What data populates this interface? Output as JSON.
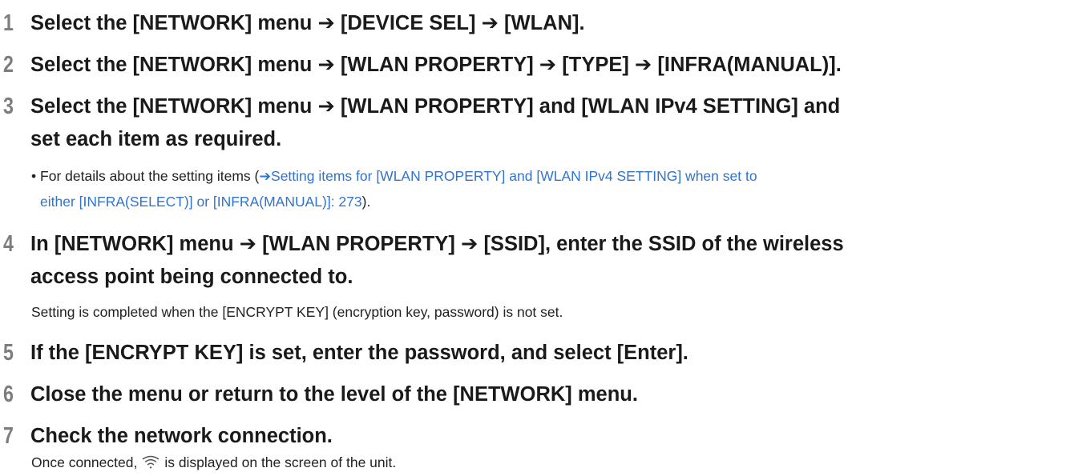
{
  "steps": [
    {
      "num": "1",
      "lines": [
        "Select the [NETWORK] menu ➔ [DEVICE SEL] ➔ [WLAN]."
      ]
    },
    {
      "num": "2",
      "lines": [
        "Select the [NETWORK] menu ➔ [WLAN PROPERTY] ➔ [TYPE] ➔ [INFRA(MANUAL)]."
      ]
    },
    {
      "num": "3",
      "lines": [
        "Select the [NETWORK] menu ➔ [WLAN PROPERTY] and [WLAN IPv4 SETTING] and",
        "set each item as required."
      ],
      "note": {
        "bullet": "•",
        "prefix": "For details about the setting items (",
        "arrow": "➔",
        "link_line1": "Setting items for [WLAN PROPERTY] and [WLAN IPv4 SETTING] when set to",
        "link_line2": "either [INFRA(SELECT)] or [INFRA(MANUAL)]: 273",
        "suffix": ")."
      }
    },
    {
      "num": "4",
      "lines": [
        "In [NETWORK] menu ➔ [WLAN PROPERTY] ➔ [SSID], enter the SSID of the wireless",
        "access point being connected to."
      ],
      "desc": "Setting is completed when the [ENCRYPT KEY] (encryption key, password) is not set."
    },
    {
      "num": "5",
      "lines": [
        "If the [ENCRYPT KEY] is set, enter the password, and select [Enter]."
      ]
    },
    {
      "num": "6",
      "lines": [
        "Close the menu or return to the level of the [NETWORK] menu."
      ]
    },
    {
      "num": "7",
      "lines": [
        "Check the network connection."
      ],
      "desc_before": "Once connected,",
      "desc_icon": "wifi-icon",
      "desc_after": "is displayed on the screen of the unit."
    }
  ],
  "colors": {
    "link": "#2f74d0",
    "step_number": "#7d7d7d",
    "text": "#1a1a1a"
  }
}
